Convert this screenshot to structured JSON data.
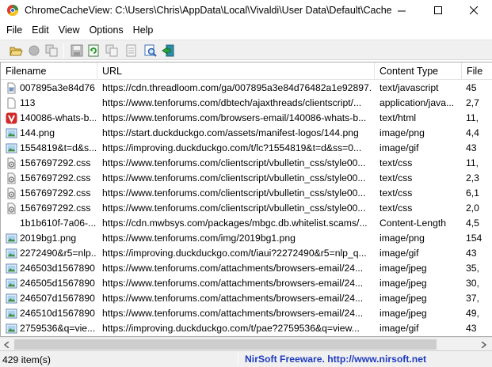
{
  "window": {
    "title": "ChromeCacheView:  C:\\Users\\Chris\\AppData\\Local\\Vivaldi\\User Data\\Default\\Cache"
  },
  "menu": [
    "File",
    "Edit",
    "View",
    "Options",
    "Help"
  ],
  "columns": {
    "filename": "Filename",
    "url": "URL",
    "content_type": "Content Type",
    "file_size": "File"
  },
  "rows": [
    {
      "filename": "007895a3e84d76...",
      "url": "https://cdn.threadloom.com/ga/007895a3e84d76482a1e92897...",
      "type": "text/javascript",
      "size": "45",
      "icon": "script-file-icon"
    },
    {
      "filename": "113",
      "url": "https://www.tenforums.com/dbtech/ajaxthreads/clientscript/...",
      "type": "application/java...",
      "size": "2,7",
      "icon": "blank-file-icon"
    },
    {
      "filename": "140086-whats-b...",
      "url": "https://www.tenforums.com/browsers-email/140086-whats-b...",
      "type": "text/html",
      "size": "11,",
      "icon": "vivaldi-icon"
    },
    {
      "filename": "144.png",
      "url": "https://start.duckduckgo.com/assets/manifest-logos/144.png",
      "type": "image/png",
      "size": "4,4",
      "icon": "image-file-icon"
    },
    {
      "filename": "1554819&t=d&s...",
      "url": "https://improving.duckduckgo.com/t/lc?1554819&t=d&ss=0...",
      "type": "image/gif",
      "size": "43",
      "icon": "image-file-icon"
    },
    {
      "filename": "1567697292.css",
      "url": "https://www.tenforums.com/clientscript/vbulletin_css/style00...",
      "type": "text/css",
      "size": "11,",
      "icon": "css-file-icon"
    },
    {
      "filename": "1567697292.css",
      "url": "https://www.tenforums.com/clientscript/vbulletin_css/style00...",
      "type": "text/css",
      "size": "2,3",
      "icon": "css-file-icon"
    },
    {
      "filename": "1567697292.css",
      "url": "https://www.tenforums.com/clientscript/vbulletin_css/style00...",
      "type": "text/css",
      "size": "6,1",
      "icon": "css-file-icon"
    },
    {
      "filename": "1567697292.css",
      "url": "https://www.tenforums.com/clientscript/vbulletin_css/style00...",
      "type": "text/css",
      "size": "2,0",
      "icon": "css-file-icon"
    },
    {
      "filename": "1b1b610f-7a06-...",
      "url": "https://cdn.mwbsys.com/packages/mbgc.db.whitelist.scams/...",
      "type": "Content-Length",
      "size": "4,5",
      "icon": "none"
    },
    {
      "filename": "2019bg1.png",
      "url": "https://www.tenforums.com/img/2019bg1.png",
      "type": "image/png",
      "size": "154",
      "icon": "image-file-icon"
    },
    {
      "filename": "2272490&r5=nlp...",
      "url": "https://improving.duckduckgo.com/t/iaui?2272490&r5=nlp_q...",
      "type": "image/gif",
      "size": "43",
      "icon": "image-file-icon"
    },
    {
      "filename": "246503d1567890...",
      "url": "https://www.tenforums.com/attachments/browsers-email/24...",
      "type": "image/jpeg",
      "size": "35,",
      "icon": "image-file-icon"
    },
    {
      "filename": "246505d1567890...",
      "url": "https://www.tenforums.com/attachments/browsers-email/24...",
      "type": "image/jpeg",
      "size": "30,",
      "icon": "image-file-icon"
    },
    {
      "filename": "246507d1567890...",
      "url": "https://www.tenforums.com/attachments/browsers-email/24...",
      "type": "image/jpeg",
      "size": "37,",
      "icon": "image-file-icon"
    },
    {
      "filename": "246510d1567890...",
      "url": "https://www.tenforums.com/attachments/browsers-email/24...",
      "type": "image/jpeg",
      "size": "49,",
      "icon": "image-file-icon"
    },
    {
      "filename": "2759536&q=vie...",
      "url": "https://improving.duckduckgo.com/t/pae?2759536&q=view...",
      "type": "image/gif",
      "size": "43",
      "icon": "image-file-icon"
    }
  ],
  "status": {
    "count": "429 item(s)",
    "link": "NirSoft Freeware.  http://www.nirsoft.net"
  },
  "colors": {
    "link": "#1f3bbf",
    "vivaldi_red": "#d32a2a"
  }
}
